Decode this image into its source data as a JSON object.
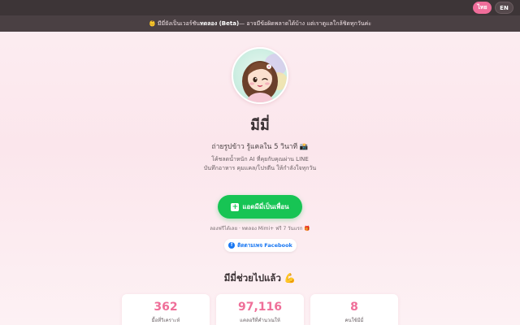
{
  "topbar": {
    "lang_th": "ไทย",
    "lang_en": "EN"
  },
  "banner": {
    "prefix": "👶 มีมี่ยังเป็นเวอร์ชัน ",
    "beta": "ทดลอง (Beta)",
    "suffix": " — อาจมีข้อผิดพลาดได้บ้าง แต่เราดูแลใกล้ชิดทุกวันค่ะ"
  },
  "hero": {
    "name": "มีมี่",
    "tagline": "ถ่ายรูปข้าว รู้แคลใน 5 วินาที 📸",
    "desc_line1": "โค้ชลดน้ำหนัก AI ที่คุยกับคุณผ่าน LINE",
    "desc_line2": "บันทึกอาหาร คุมแคล/โปรตีน ให้กำลังใจทุกวัน",
    "cta_label": "แอดมีมี่เป็นเพื่อน",
    "trial_text": "ลองฟรีได้เลย · ทดลอง Mimi+ ฟรี 7 วันแรก 🎁",
    "facebook_label": "ติดตามเพจ Facebook"
  },
  "stats": {
    "title": "มีมี่ช่วยไปแล้ว 💪",
    "items": [
      {
        "value": "362",
        "label": "มื้อที่วิเคราะห์"
      },
      {
        "value": "97,116",
        "label": "แคลอรีที่คำนวณให้"
      },
      {
        "value": "8",
        "label": "คนใช้มีมี่"
      }
    ]
  },
  "colors": {
    "accent_pink": "#ef6f99",
    "line_green": "#17c454",
    "facebook_blue": "#1877f2"
  }
}
